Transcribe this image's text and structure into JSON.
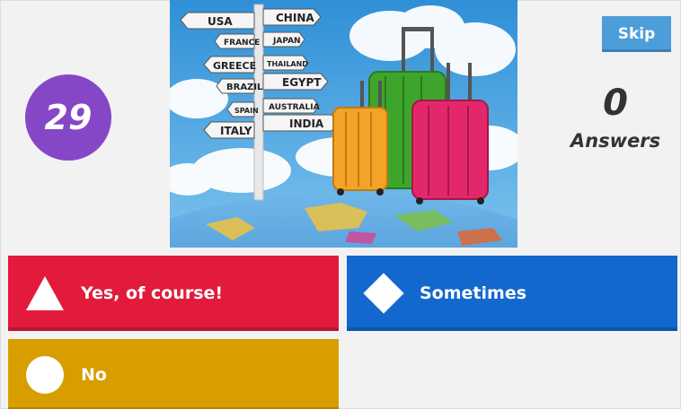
{
  "timer": {
    "value": "29"
  },
  "skip": {
    "label": "Skip"
  },
  "answers": {
    "count": "0",
    "label": "Answers"
  },
  "image": {
    "signs": [
      "USA",
      "CHINA",
      "FRANCE",
      "JAPAN",
      "GREECE",
      "THAILAND",
      "BRAZIL",
      "EGYPT",
      "SPAIN",
      "AUSTRALIA",
      "ITALY",
      "INDIA"
    ]
  },
  "options": [
    {
      "label": "Yes, of course!",
      "shape": "triangle-icon",
      "color": "#e21b3c"
    },
    {
      "label": "Sometimes",
      "shape": "diamond-icon",
      "color": "#1368ce"
    },
    {
      "label": "No",
      "shape": "circle-icon",
      "color": "#d89e00"
    }
  ]
}
